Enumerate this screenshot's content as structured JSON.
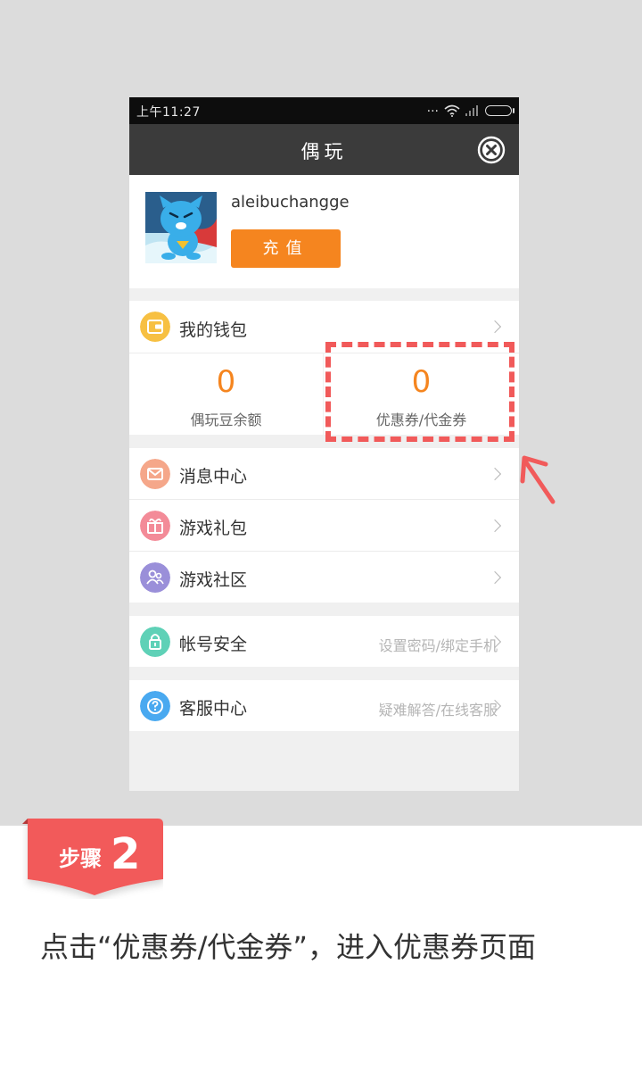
{
  "status_bar": {
    "time": "上午11:27",
    "dots": "..."
  },
  "header": {
    "title": "偶玩"
  },
  "profile": {
    "username": "aleibuchangge",
    "recharge_label": "充值"
  },
  "wallet": {
    "label": "我的钱包",
    "balance_value": "0",
    "balance_label": "偶玩豆余额",
    "coupon_value": "0",
    "coupon_label": "优惠券/代金券"
  },
  "menu": [
    {
      "label": "消息中心",
      "icon": "mail-icon",
      "color": "#f5a78a"
    },
    {
      "label": "游戏礼包",
      "icon": "gift-icon",
      "color": "#f38b98"
    },
    {
      "label": "游戏社区",
      "icon": "community-icon",
      "color": "#9a8fd9"
    }
  ],
  "account": {
    "label": "帐号安全",
    "sub": "设置密码/绑定手机",
    "icon": "lock-icon",
    "color": "#5fd1b7"
  },
  "service": {
    "label": "客服中心",
    "sub": "疑难解答/在线客服",
    "icon": "help-icon",
    "color": "#49a9f0"
  },
  "tutorial": {
    "step_word": "步骤",
    "step_number": "2",
    "instruction": "点击“优惠券/代金券”，进入优惠券页面"
  },
  "colors": {
    "accent": "#f5851f",
    "highlight": "#f15a5a",
    "wallet_icon": "#f7c042"
  }
}
